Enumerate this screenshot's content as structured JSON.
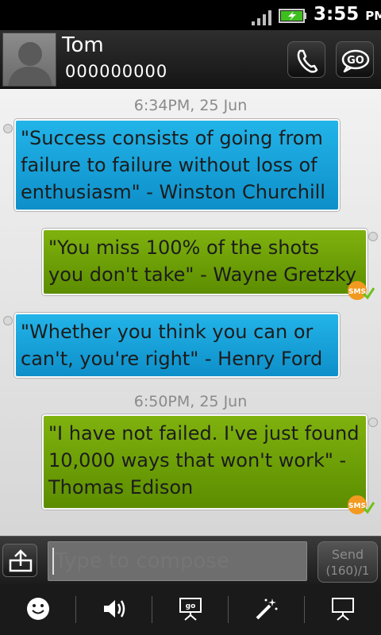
{
  "status_bar": {
    "time": "3:55",
    "ampm": "PM",
    "icons": [
      "signal-icon",
      "battery-charging-icon"
    ]
  },
  "header": {
    "contact_name": "Tom",
    "contact_number": "000000000",
    "buttons": [
      "phone-icon",
      "go-icon"
    ],
    "go_label": "GO"
  },
  "conversation": {
    "timestamps": [
      "6:34PM, 25 Jun",
      "6:50PM, 25 Jun"
    ],
    "messages": [
      {
        "direction": "incoming",
        "lines": [
          "\"Success consists of going from",
          "failure to failure without loss of",
          "enthusiasm\" - Winston Churchill"
        ]
      },
      {
        "direction": "outgoing",
        "lines": [
          "\"You miss 100% of the shots",
          "you don't take\" - Wayne Gretzky"
        ],
        "badge": "SMS"
      },
      {
        "direction": "incoming",
        "lines": [
          "\"Whether you think you can or",
          "can't, you're right\" - Henry Ford"
        ]
      },
      {
        "direction": "outgoing",
        "lines": [
          "\"I have not failed. I've just found",
          "10,000 ways that won't work\" -",
          "Thomas Edison"
        ],
        "badge": "SMS"
      }
    ]
  },
  "compose": {
    "placeholder": "Type to compose",
    "send_label": "Send",
    "send_count": "(160)/1"
  },
  "toolbar": {
    "icons": [
      "smiley-icon",
      "volume-icon",
      "go-slideshow-icon",
      "magic-wand-icon",
      "slideshow-icon"
    ],
    "go_label": "go"
  },
  "colors": {
    "incoming_bubble": "#1aa6dc",
    "outgoing_bubble": "#6fa30a",
    "sms_badge": "#f29a1f",
    "check": "#6cc21a"
  }
}
